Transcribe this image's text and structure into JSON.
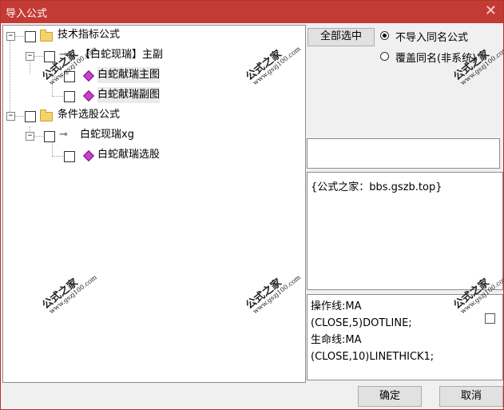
{
  "window": {
    "title": "导入公式"
  },
  "tree": {
    "root1": {
      "label": "技术指标公式"
    },
    "item1": {
      "label": "【白蛇现瑞】主副"
    },
    "item1_children": [
      {
        "label": "白蛇献瑞主图"
      },
      {
        "label": "白蛇献瑞副图"
      }
    ],
    "root2": {
      "label": "条件选股公式"
    },
    "item2": {
      "label": "白蛇现瑞xg"
    },
    "item2_children": [
      {
        "label": "白蛇献瑞选股"
      }
    ]
  },
  "controls": {
    "select_all_label": "全部选中",
    "radio_skip_label": "不导入同名公式",
    "radio_overwrite_label": "覆盖同名(非系统)"
  },
  "description": "{公式之家：bbs.gszb.top}",
  "code_lines": [
    "操作线:MA",
    "(CLOSE,5)DOTLINE;",
    "生命线:MA",
    "(CLOSE,10)LINETHICK1;"
  ],
  "buttons": {
    "ok_label": "确定",
    "cancel_label": "取消"
  },
  "watermark": {
    "text": "公式之家",
    "url": "www.gszj100.com"
  }
}
